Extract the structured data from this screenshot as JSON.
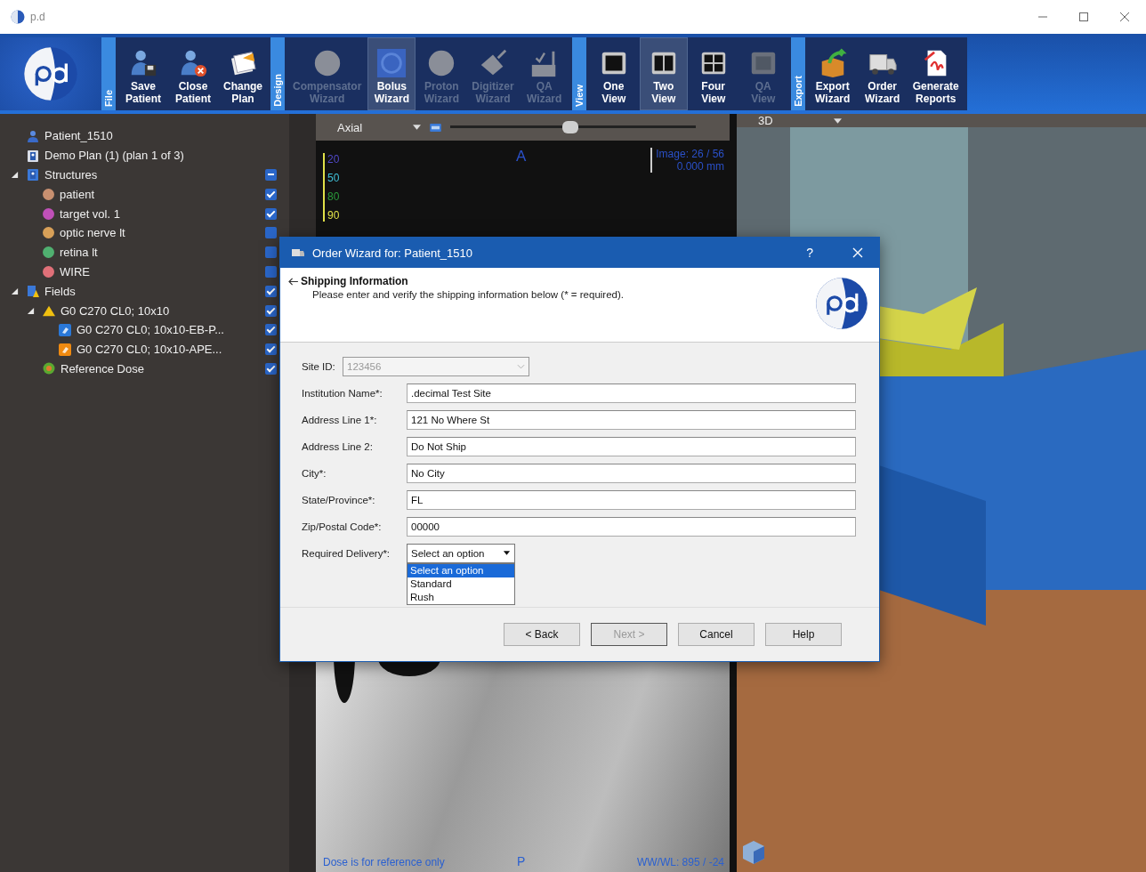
{
  "app": {
    "title": "p.d"
  },
  "ribbon": {
    "groups": [
      {
        "label": "File",
        "buttons": [
          {
            "kind": "save",
            "label": "Save Patient",
            "disabled": false,
            "selected": false
          },
          {
            "kind": "close",
            "label": "Close Patient",
            "disabled": false,
            "selected": false
          },
          {
            "kind": "plan",
            "label": "Change Plan",
            "disabled": false,
            "selected": false
          }
        ]
      },
      {
        "label": "Design",
        "buttons": [
          {
            "kind": "disc",
            "label": "Compensator Wizard",
            "disabled": true,
            "selected": false
          },
          {
            "kind": "bolus",
            "label": "Bolus Wizard",
            "disabled": false,
            "selected": true
          },
          {
            "kind": "disc",
            "label": "Proton Wizard",
            "disabled": true,
            "selected": false
          },
          {
            "kind": "digitizer",
            "label": "Digitizer Wizard",
            "disabled": true,
            "selected": false
          },
          {
            "kind": "qa",
            "label": "QA Wizard",
            "disabled": true,
            "selected": false
          }
        ]
      },
      {
        "label": "View",
        "buttons": [
          {
            "kind": "view1",
            "label": "One View",
            "disabled": false,
            "selected": false
          },
          {
            "kind": "view2",
            "label": "Two View",
            "disabled": false,
            "selected": true
          },
          {
            "kind": "view4",
            "label": "Four View",
            "disabled": false,
            "selected": false
          },
          {
            "kind": "viewqa",
            "label": "QA View",
            "disabled": true,
            "selected": false
          }
        ]
      },
      {
        "label": "Export",
        "buttons": [
          {
            "kind": "export",
            "label": "Export Wizard",
            "disabled": false,
            "selected": false
          },
          {
            "kind": "order",
            "label": "Order Wizard",
            "disabled": false,
            "selected": false
          },
          {
            "kind": "reports",
            "label": "Generate Reports",
            "disabled": false,
            "selected": false
          }
        ]
      }
    ]
  },
  "tree": [
    {
      "kind": "patient",
      "label": "Patient_1510"
    },
    {
      "kind": "plan",
      "label": "Demo Plan (1) (plan 1 of 3)"
    },
    {
      "kind": "structures",
      "label": "Structures",
      "expanded": true,
      "checked": true,
      "mixed": true,
      "children": [
        {
          "kind": "structure",
          "label": "patient",
          "color": "#c89070",
          "checked": true
        },
        {
          "kind": "structure",
          "label": "target vol. 1",
          "color": "#c050b8",
          "checked": true
        },
        {
          "kind": "structure",
          "label": "optic nerve lt",
          "color": "#d8a058",
          "checked": false
        },
        {
          "kind": "structure",
          "label": "retina lt",
          "color": "#50b070",
          "checked": false
        },
        {
          "kind": "structure",
          "label": "WIRE",
          "color": "#e07078",
          "checked": false
        }
      ]
    },
    {
      "kind": "fields",
      "label": "Fields",
      "expanded": true,
      "checked": true,
      "children": [
        {
          "kind": "field",
          "label": "G0 C270 CL0; 10x10",
          "expanded": true,
          "checked": true,
          "children": [
            {
              "kind": "bolus",
              "label": "G0 C270 CL0; 10x10-EB-P...",
              "checked": true
            },
            {
              "kind": "aperture",
              "label": "G0 C270 CL0; 10x10-APE...",
              "checked": true
            }
          ]
        },
        {
          "kind": "dose",
          "label": "Reference Dose",
          "checked": true
        }
      ]
    }
  ],
  "axial": {
    "view_select": "Axial",
    "slider": {
      "level": 0.49
    },
    "orientation_top": "A",
    "orientation_bottom": "P",
    "image_info": "Image: 26 / 56",
    "slice_position": "0.000 mm",
    "dose_levels": [
      {
        "label": "20",
        "color": "#5048c8"
      },
      {
        "label": "50",
        "color": "#40c0d8"
      },
      {
        "label": "80",
        "color": "#2a9a3a"
      },
      {
        "label": "90",
        "color": "#e0e048"
      }
    ],
    "dose_note": "Dose is for reference only",
    "window_level": "WW/WL: 895 / -24"
  },
  "three_d": {
    "view_select": "3D"
  },
  "dialog": {
    "title": "Order Wizard for: Patient_1510",
    "help_glyph": "?",
    "page_title": "Shipping Information",
    "instructions": "Please enter and verify the shipping information below (* = required).",
    "fields": [
      {
        "kind": "combo",
        "label": "Site ID:",
        "value": "123456",
        "disabled": true
      },
      {
        "kind": "text",
        "label": "Institution Name*:",
        "value": ".decimal Test Site"
      },
      {
        "kind": "text",
        "label": "Address Line 1*:",
        "value": "121 No Where St"
      },
      {
        "kind": "text",
        "label": "Address Line 2:",
        "value": "Do Not Ship"
      },
      {
        "kind": "text",
        "label": "City*:",
        "value": "No City"
      },
      {
        "kind": "text",
        "label": "State/Province*:",
        "value": "FL"
      },
      {
        "kind": "text",
        "label": "Zip/Postal Code*:",
        "value": "00000"
      },
      {
        "kind": "dropdown",
        "label": "Required Delivery*:",
        "value": "Select an option",
        "expanded": true,
        "options": [
          {
            "label": "Select an option",
            "selected": true
          },
          {
            "label": "Standard",
            "selected": false
          },
          {
            "label": "Rush",
            "selected": false
          }
        ]
      }
    ],
    "buttons": [
      {
        "label": "< Back",
        "disabled": false
      },
      {
        "label": "Next >",
        "disabled": true
      },
      {
        "label": "Cancel",
        "disabled": false
      },
      {
        "label": "Help",
        "disabled": false
      }
    ]
  }
}
